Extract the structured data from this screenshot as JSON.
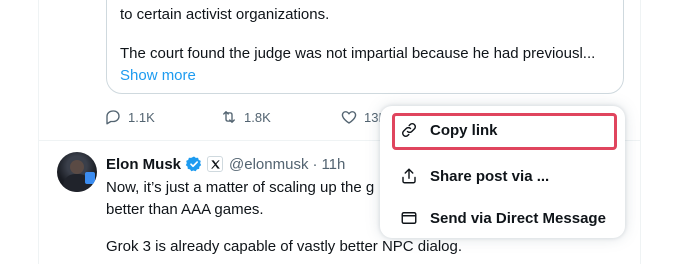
{
  "quoted_post": {
    "line1": "to certain activist organizations.",
    "line2": "The court found the judge was not impartial because he had previousl...",
    "show_more": "Show more"
  },
  "actions": {
    "replies": "1.1K",
    "reposts": "1.8K",
    "likes": "13K"
  },
  "post": {
    "author_name": "Elon Musk",
    "handle": "@elonmusk",
    "separator": "·",
    "time": "11h",
    "line1": "Now, it’s just a matter of scaling up the g",
    "line2": "better than AAA games.",
    "line3": "Grok 3 is already capable of vastly better NPC dialog."
  },
  "menu": {
    "items": [
      {
        "label": "Copy link",
        "icon": "link-icon"
      },
      {
        "label": "Share post via ...",
        "icon": "share-icon"
      },
      {
        "label": "Send via Direct Message",
        "icon": "envelope-icon"
      }
    ]
  },
  "colors": {
    "accent": "#1d9bf0",
    "highlight": "#e0455e",
    "muted": "#536471",
    "text": "#0f1419",
    "verified": "#1d9bf0"
  }
}
